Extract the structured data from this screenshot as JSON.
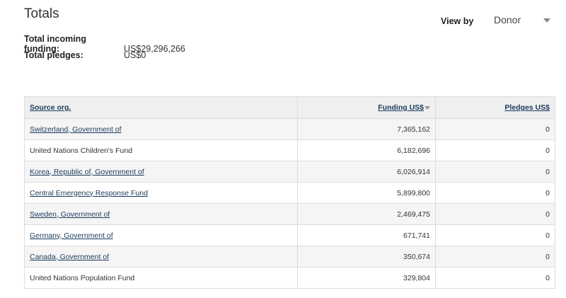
{
  "totals": {
    "title": "Totals",
    "incoming_label": "Total incoming funding:",
    "incoming_value": "US$29,296,266",
    "pledges_label": "Total pledges:",
    "pledges_value": "US$0"
  },
  "view_by": {
    "label": "View by",
    "selected": "Donor"
  },
  "table": {
    "headers": {
      "source": "Source org.",
      "funding": "Funding US$",
      "pledges": "Pledges US$"
    },
    "rows": [
      {
        "source": "Switzerland, Government of",
        "linked": true,
        "funding": "7,365,162",
        "pledges": "0"
      },
      {
        "source": "United Nations Children's Fund",
        "linked": false,
        "funding": "6,182,696",
        "pledges": "0"
      },
      {
        "source": "Korea, Republic of, Government of",
        "linked": true,
        "funding": "6,026,914",
        "pledges": "0"
      },
      {
        "source": "Central Emergency Response Fund",
        "linked": true,
        "funding": "5,899,800",
        "pledges": "0"
      },
      {
        "source": "Sweden, Government of",
        "linked": true,
        "funding": "2,469,475",
        "pledges": "0"
      },
      {
        "source": "Germany, Government of",
        "linked": true,
        "funding": "671,741",
        "pledges": "0"
      },
      {
        "source": "Canada, Government of",
        "linked": true,
        "funding": "350,674",
        "pledges": "0"
      },
      {
        "source": "United Nations Population Fund",
        "linked": false,
        "funding": "329,804",
        "pledges": "0"
      }
    ]
  }
}
